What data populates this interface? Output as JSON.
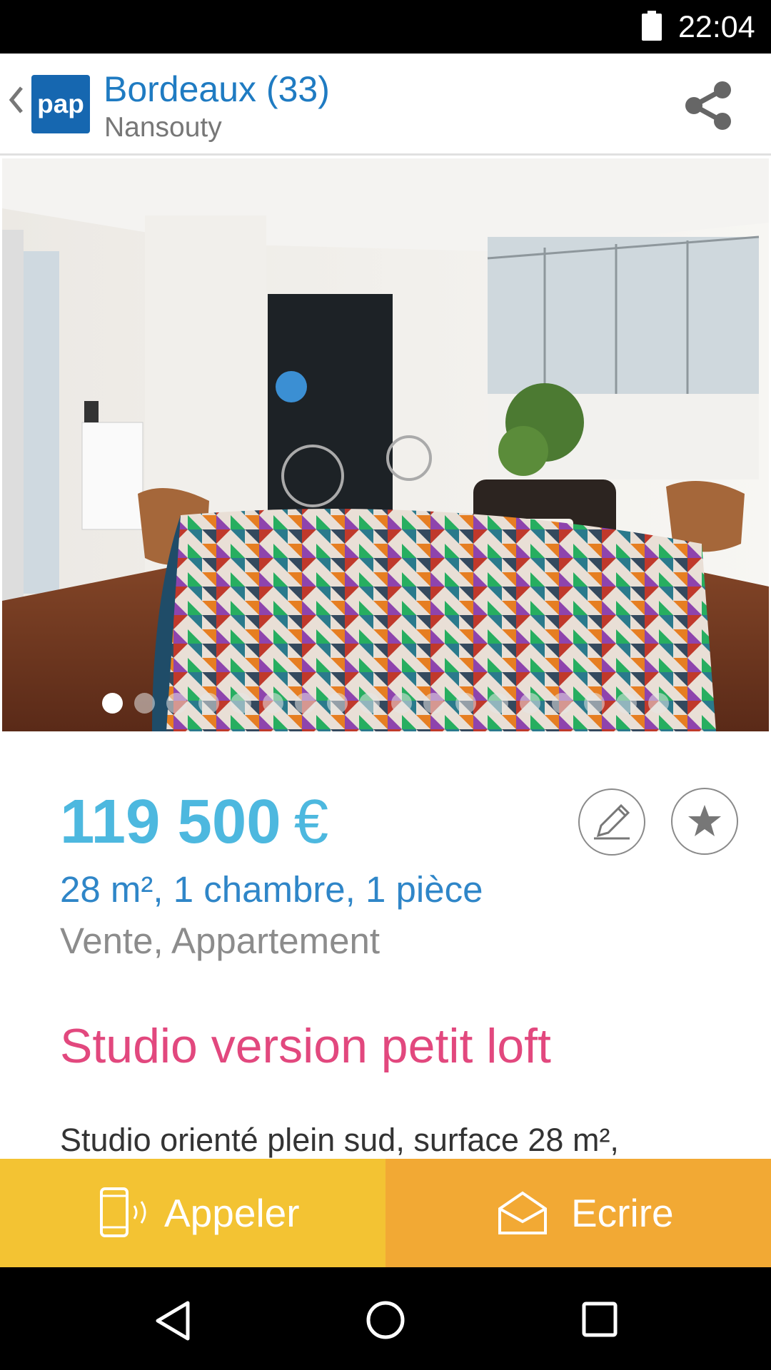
{
  "status_bar": {
    "time": "22:04",
    "battery_icon": "battery-icon"
  },
  "header": {
    "logo_text": "pap",
    "city": "Bordeaux (33)",
    "district": "Nansouty",
    "back_icon": "chevron-left-icon",
    "share_icon": "share-icon"
  },
  "gallery": {
    "image": "living-room-photo",
    "photo_count": 18,
    "active_index": 0
  },
  "listing": {
    "price_amount": "119 500",
    "currency": "€",
    "specs": "28 m², 1 chambre, 1 pièce",
    "type": "Vente, Appartement",
    "title": "Studio version petit loft",
    "description_start": "Studio orienté plein sud, surface 28 m²,"
  },
  "actions": {
    "call_label": "Appeler",
    "write_label": "Ecrire",
    "call_icon": "phone-ringing-icon",
    "write_icon": "envelope-icon",
    "edit_icon": "pencil-icon",
    "favorite_icon": "star-icon"
  },
  "colors": {
    "price": "#4db8df",
    "specs": "#2f86c8",
    "title": "#e2487e",
    "call_bg": "#f3c333",
    "write_bg": "#f2a934",
    "logo_bg": "#1667b0"
  },
  "nav": {
    "back": "nav-back-icon",
    "home": "nav-home-icon",
    "recents": "nav-recents-icon"
  }
}
